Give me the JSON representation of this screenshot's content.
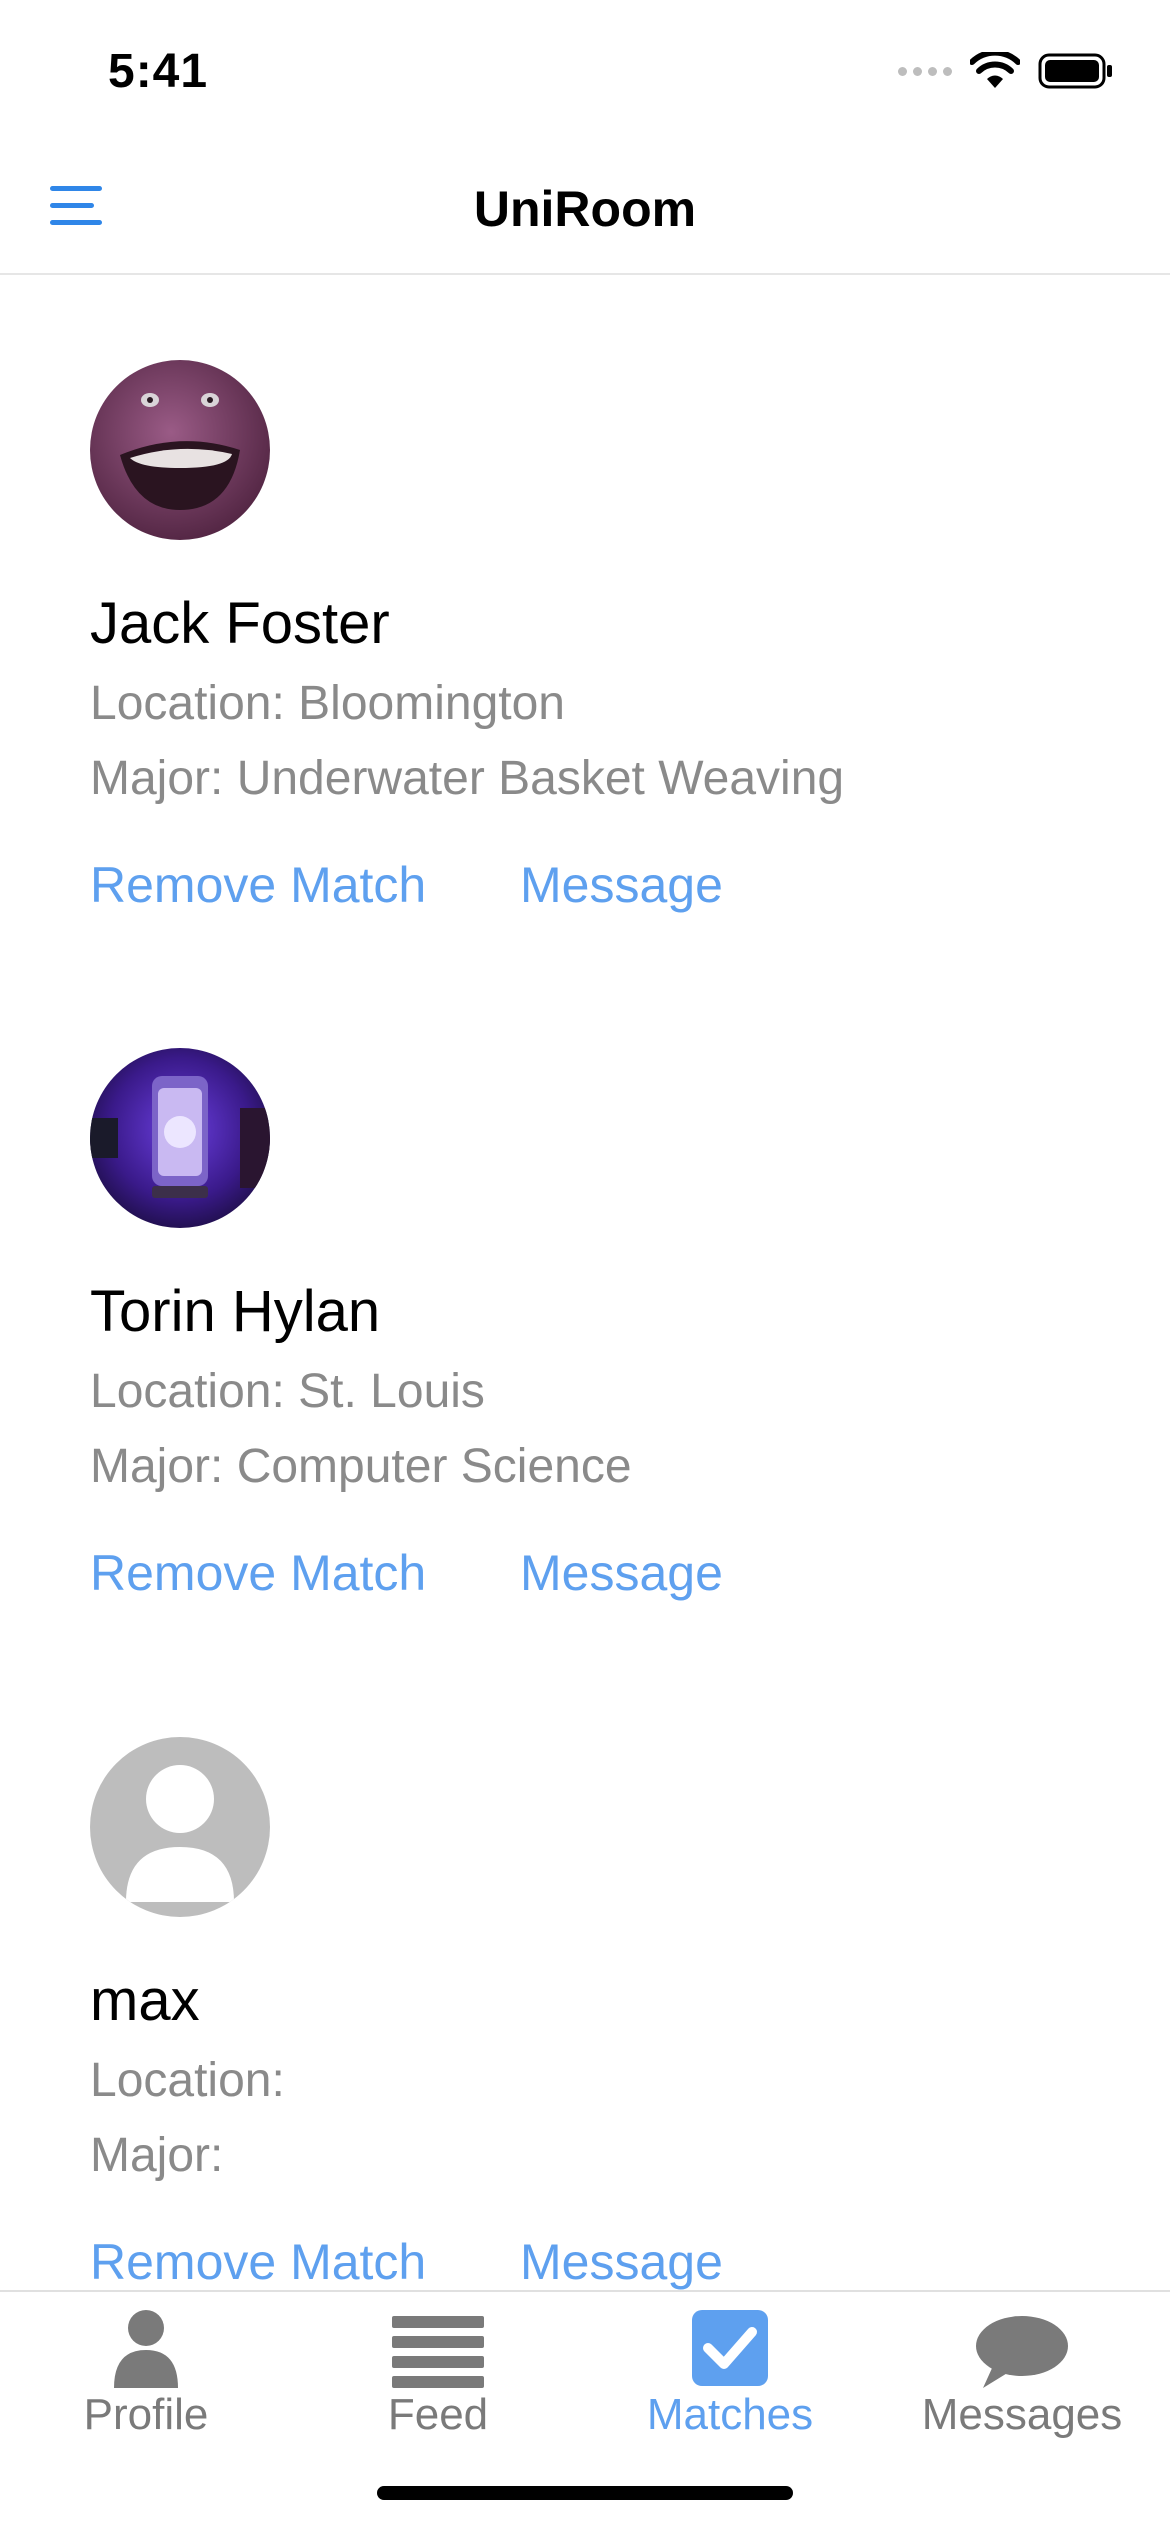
{
  "status": {
    "time": "5:41"
  },
  "app": {
    "title": "UniRoom"
  },
  "matches": [
    {
      "name": "Jack Foster",
      "location": "Location: Bloomington",
      "major": "Major: Underwater Basket Weaving",
      "remove_label": "Remove Match",
      "message_label": "Message",
      "avatar": "purple-dinosaur-photo"
    },
    {
      "name": "Torin Hylan",
      "location": "Location: St. Louis",
      "major": "Major: Computer Science",
      "remove_label": "Remove Match",
      "message_label": "Message",
      "avatar": "lamp-photo"
    },
    {
      "name": "max",
      "location": "Location:",
      "major": "Major:",
      "remove_label": "Remove Match",
      "message_label": "Message",
      "avatar": "default-person-icon"
    }
  ],
  "tabs": [
    {
      "label": "Profile",
      "icon": "person-icon",
      "active": false
    },
    {
      "label": "Feed",
      "icon": "list-icon",
      "active": false
    },
    {
      "label": "Matches",
      "icon": "checkbox-icon",
      "active": true
    },
    {
      "label": "Messages",
      "icon": "chat-bubble-icon",
      "active": false
    }
  ],
  "colors": {
    "accent": "#5ea0ef",
    "menu_icon": "#2f86e8",
    "secondary_text": "#8a8a8a",
    "inactive_tab": "#7a7a7a"
  }
}
